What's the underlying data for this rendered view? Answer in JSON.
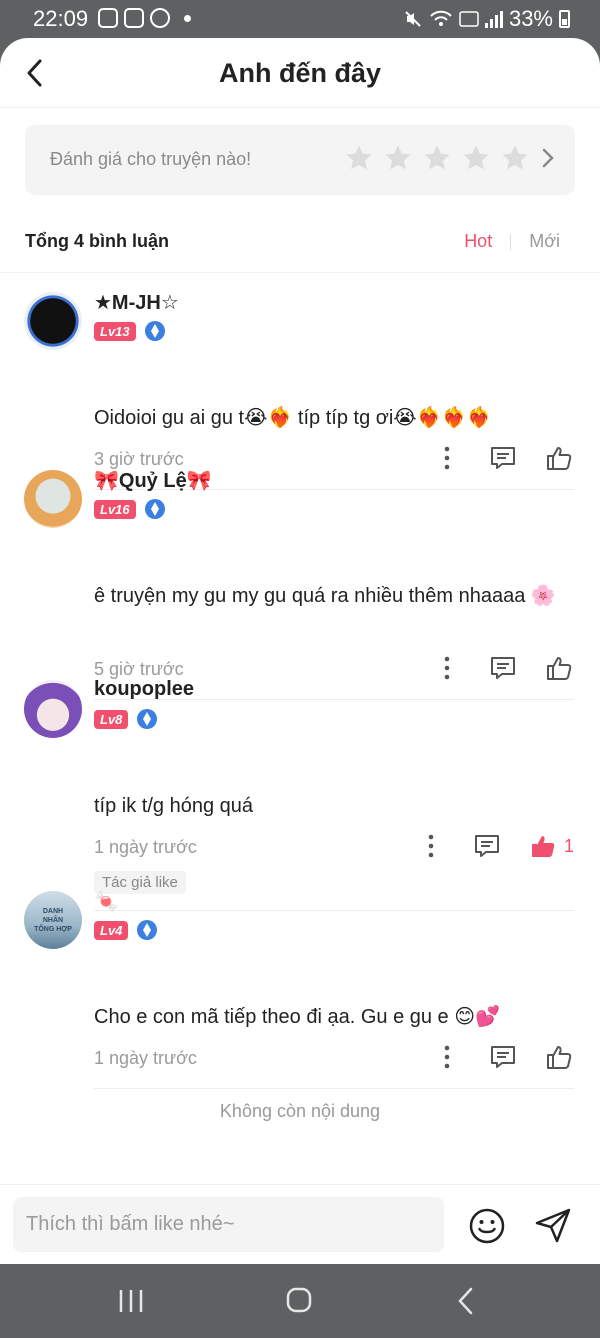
{
  "status_bar": {
    "time": "22:09",
    "battery": "33%"
  },
  "header": {
    "title": "Anh đến đây"
  },
  "rating": {
    "prompt": "Đánh giá cho truyện nào!",
    "stars": 5
  },
  "comments_header": {
    "summary": "Tổng 4 bình luận",
    "sort_hot": "Hot",
    "sort_new": "Mới"
  },
  "comments": [
    {
      "username": "★M-JH☆",
      "level": "Lv13",
      "text": "Oidoioi gu ai gu t😭❤️‍🔥 típ típ tg ơi😭❤️‍🔥❤️‍🔥❤️‍🔥",
      "time": "3 giờ trước"
    },
    {
      "username": "🎀Quỷ Lệ🎀",
      "level": "Lv16",
      "text": "ê truyện my gu my gu quá ra nhiều thêm nhaaaa 🌸",
      "time": "5 giờ trước"
    },
    {
      "username": "koupoplee",
      "level": "Lv8",
      "text": "típ ik t/g hóng quá",
      "time": "1 ngày trước",
      "likes": "1",
      "author_tag": "Tác giả like"
    },
    {
      "username": "🍬",
      "level": "Lv4",
      "text": "Cho e con mã tiếp theo đi ạa. Gu e gu e 😊💕",
      "time": "1 ngày trước",
      "avatar_text": "DANH NHÂN TỔNG HỢP"
    }
  ],
  "end_message": "Không còn nội dung",
  "input": {
    "placeholder": "Thích thì bấm like nhé~"
  },
  "colors": {
    "accent": "#f0506e",
    "muted": "#9a9a9a",
    "level_badge": "#f0506e",
    "verified": "#3b7fe0"
  }
}
